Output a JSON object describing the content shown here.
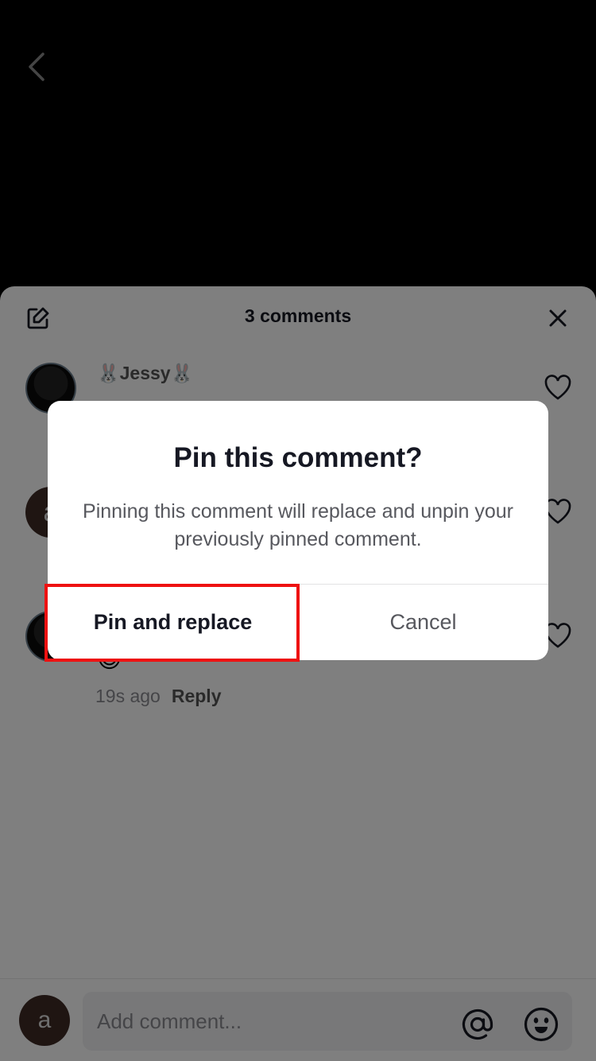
{
  "nav": {
    "back_icon": "chevron-left-icon"
  },
  "sheet": {
    "title": "3 comments",
    "edit_icon": "edit-icon",
    "close_icon": "close-icon",
    "comments": [
      {
        "username": "🐰Jessy🐰",
        "avatar": "anime-avatar"
      },
      {
        "username": "",
        "avatar_letter": "a"
      },
      {
        "username": "",
        "avatar": "anime-avatar",
        "emoji": "😊",
        "time": "19s ago",
        "reply_label": "Reply"
      }
    ]
  },
  "input": {
    "avatar_letter": "a",
    "placeholder": "Add comment...",
    "mention_icon": "at-icon",
    "emoji_icon": "emoji-icon"
  },
  "dialog": {
    "title": "Pin this comment?",
    "message": "Pinning this comment will replace and unpin your previously pinned comment.",
    "primary_label": "Pin and replace",
    "cancel_label": "Cancel"
  },
  "colors": {
    "highlight": "#ee1111",
    "text_primary": "#161823",
    "text_secondary": "#57585e"
  }
}
